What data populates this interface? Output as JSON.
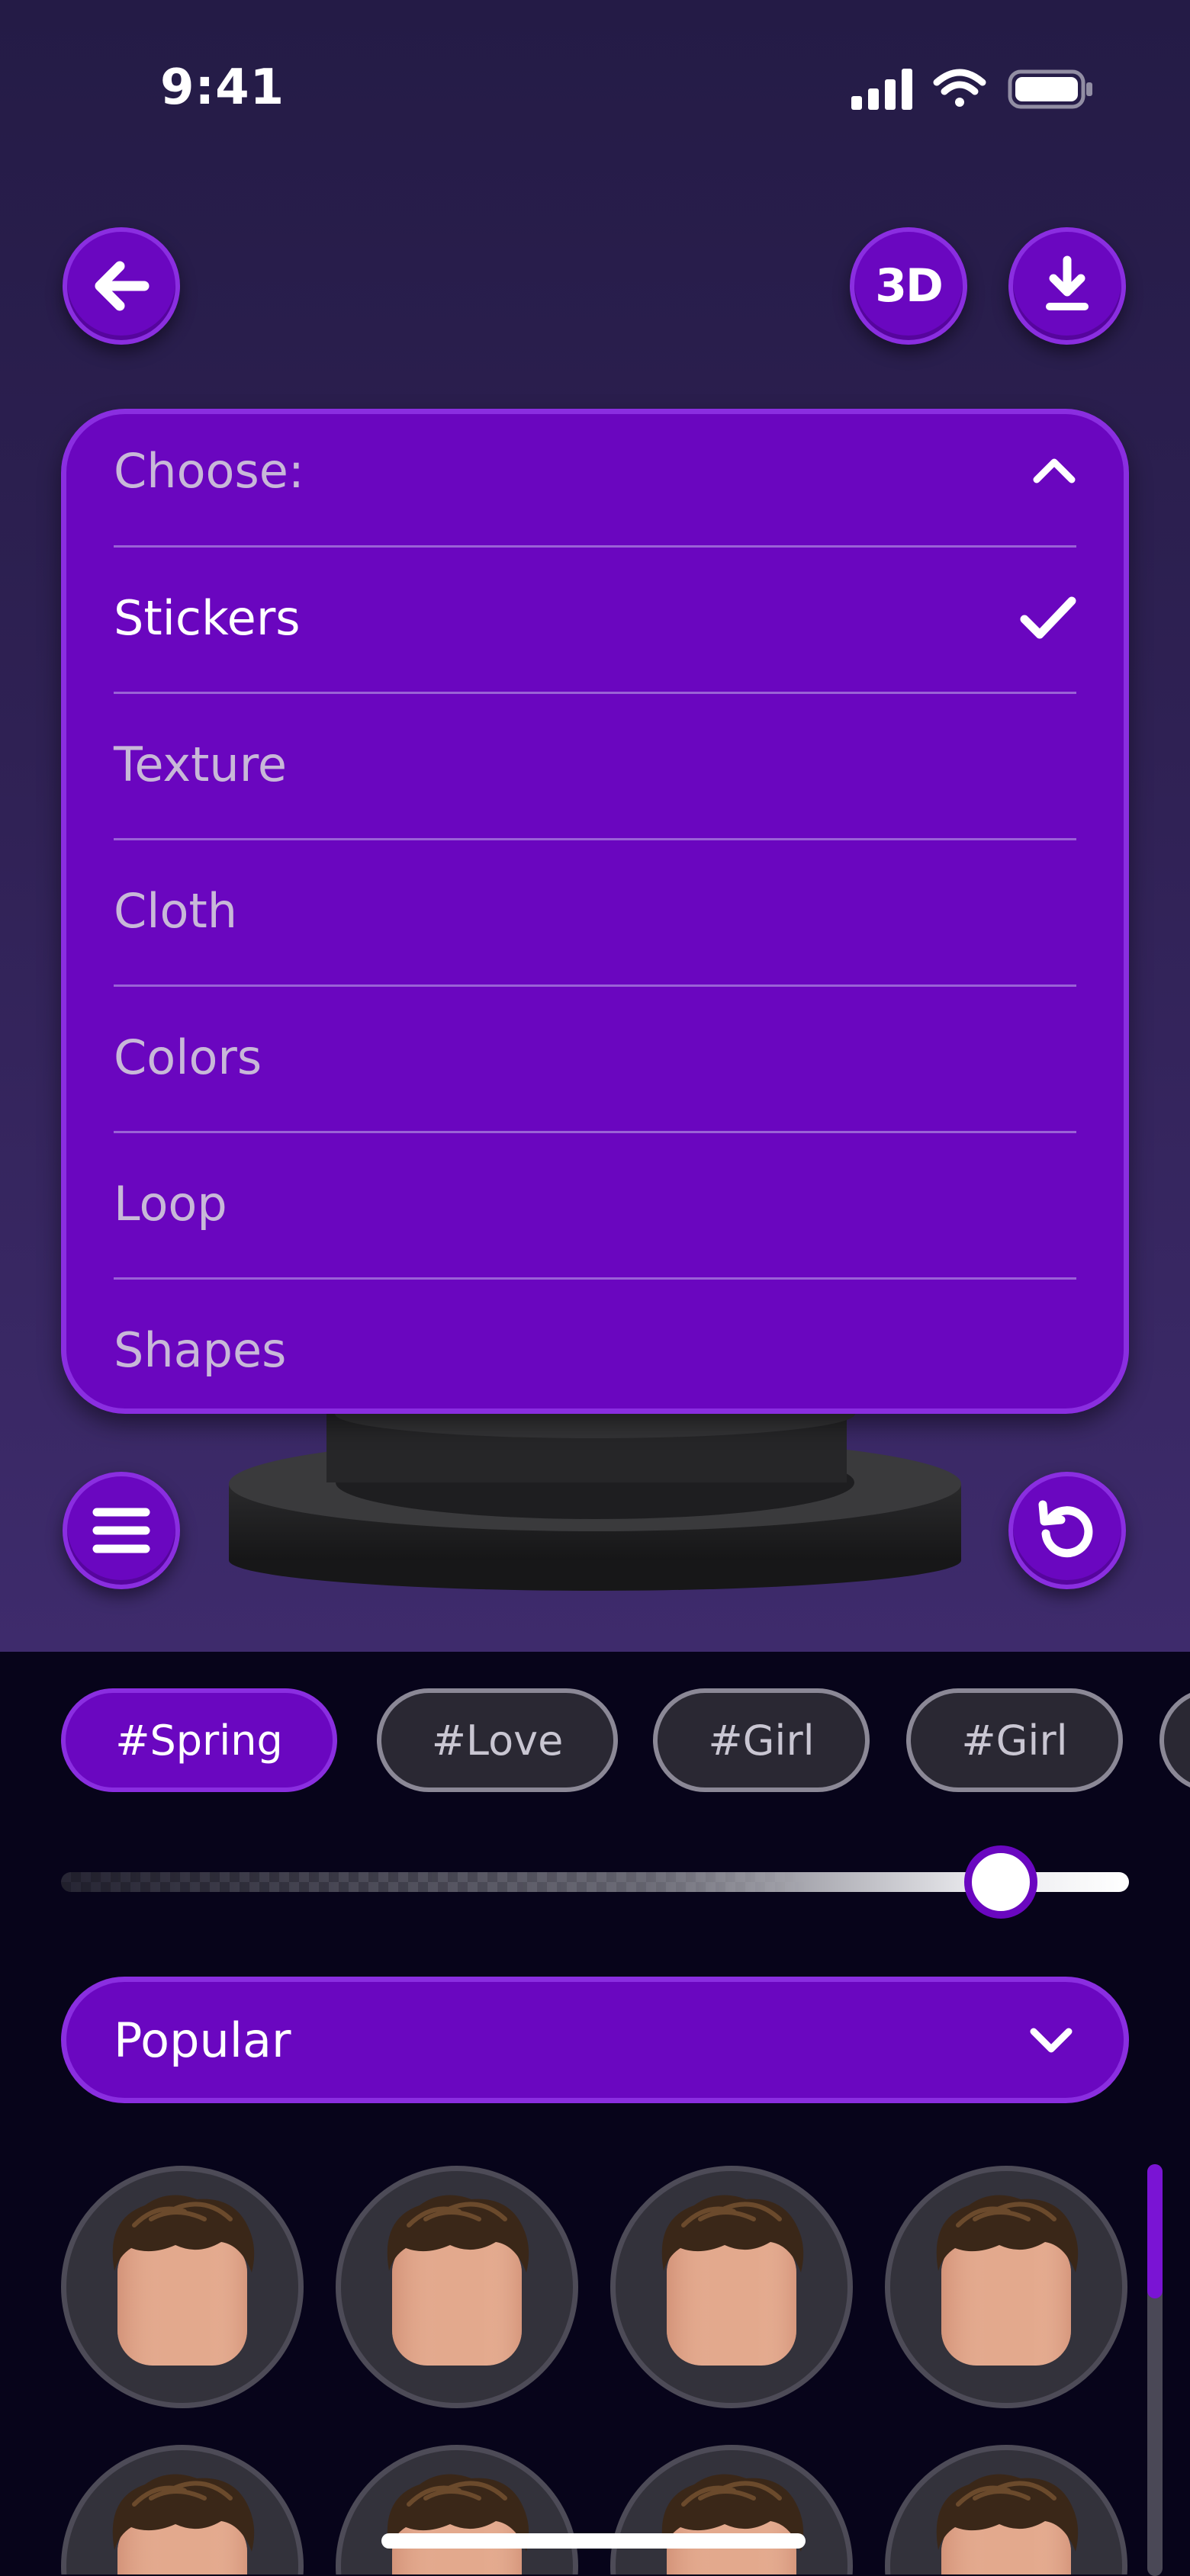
{
  "status_bar": {
    "time": "9:41"
  },
  "toolbar": {
    "back_icon": "arrow-left-icon",
    "view_3d_label": "3D",
    "download_icon": "download-icon",
    "menu_icon": "hamburger-menu-icon",
    "reset_icon": "rotate-ccw-icon"
  },
  "dropdown": {
    "header_label": "Choose:",
    "expanded": true,
    "items": [
      {
        "label": "Stickers",
        "selected": true
      },
      {
        "label": "Texture",
        "selected": false
      },
      {
        "label": "Cloth",
        "selected": false
      },
      {
        "label": "Colors",
        "selected": false
      },
      {
        "label": "Loop",
        "selected": false
      },
      {
        "label": "Shapes",
        "selected": false
      }
    ]
  },
  "tags": [
    {
      "label": "#Spring",
      "active": true
    },
    {
      "label": "#Love",
      "active": false
    },
    {
      "label": "#Girl",
      "active": false
    },
    {
      "label": "#Girl",
      "active": false
    },
    {
      "label": "",
      "active": false
    }
  ],
  "opacity_slider": {
    "value_fraction": 0.88
  },
  "category_select": {
    "value": "Popular"
  },
  "items_grid": {
    "columns": 4,
    "visible_rows": 2,
    "item_icon": "avatar-head-icon"
  },
  "scrollbar": {
    "position_fraction": 0.0,
    "thumb_fraction": 0.33
  },
  "colors": {
    "accent": "#6a07c0",
    "accent_border": "#8a2ee0",
    "background_top": "#241b46",
    "background_bottom": "#07041a",
    "chip_inactive": "#2a2833"
  }
}
